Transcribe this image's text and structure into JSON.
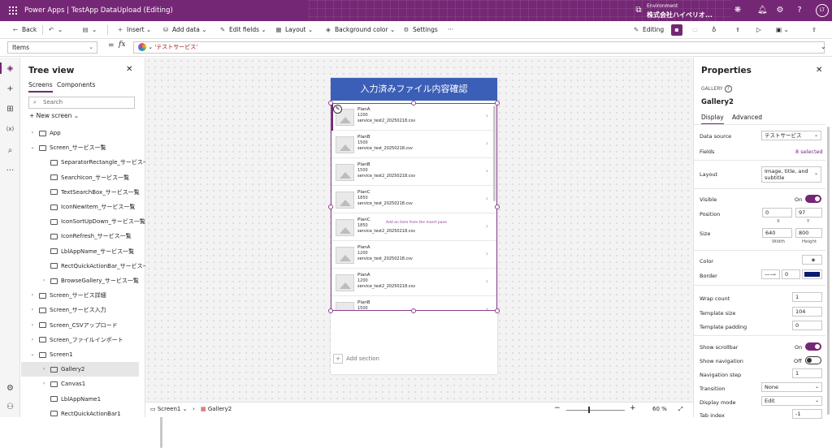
{
  "topbar": {
    "app_name": "Power Apps",
    "separator": "|",
    "doc_title": "TestApp DataUpload (Editing)",
    "env_label": "Environment",
    "env_name": "株式会社ハイペリオ...",
    "avatar": "LT"
  },
  "commandbar": {
    "back": "Back",
    "insert": "Insert",
    "add_data": "Add data",
    "edit_fields": "Edit fields",
    "layout": "Layout",
    "background_color": "Background color",
    "settings": "Settings",
    "more": "···",
    "editing": "Editing"
  },
  "formula": {
    "property": "Items",
    "equals": "=",
    "fx": "fx",
    "value": "'テストサービス'"
  },
  "tree": {
    "title": "Tree view",
    "tabs": [
      "Screens",
      "Components"
    ],
    "search_placeholder": "Search",
    "new_screen": "New screen",
    "nodes": [
      {
        "label": "App",
        "indent": 0,
        "icon": "app-icon",
        "chev": "›"
      },
      {
        "label": "Screen_サービス一覧",
        "indent": 0,
        "icon": "screen-icon",
        "chev": "⌄"
      },
      {
        "label": "SeparatorRectangle_サービス一覧",
        "indent": 1,
        "icon": "rectangle-icon",
        "chev": ""
      },
      {
        "label": "SearchIcon_サービス一覧",
        "indent": 1,
        "icon": "icon-icon",
        "chev": ""
      },
      {
        "label": "TextSearchBox_サービス一覧",
        "indent": 1,
        "icon": "textinput-icon",
        "chev": ""
      },
      {
        "label": "IconNewItem_サービス一覧",
        "indent": 1,
        "icon": "icon-icon",
        "chev": ""
      },
      {
        "label": "IconSortUpDown_サービス一覧",
        "indent": 1,
        "icon": "icon-icon",
        "chev": ""
      },
      {
        "label": "IconRefresh_サービス一覧",
        "indent": 1,
        "icon": "icon-icon",
        "chev": ""
      },
      {
        "label": "LblAppName_サービス一覧",
        "indent": 1,
        "icon": "label-icon",
        "chev": ""
      },
      {
        "label": "RectQuickActionBar_サービス一覧",
        "indent": 1,
        "icon": "rectangle-icon",
        "chev": ""
      },
      {
        "label": "BrowseGallery_サービス一覧",
        "indent": 1,
        "icon": "gallery-icon",
        "chev": "›"
      },
      {
        "label": "Screen_サービス詳細",
        "indent": 0,
        "icon": "screen-icon",
        "chev": "›"
      },
      {
        "label": "Screen_サービス入力",
        "indent": 0,
        "icon": "screen-icon",
        "chev": "›"
      },
      {
        "label": "Screen_CSVアップロード",
        "indent": 0,
        "icon": "screen-icon",
        "chev": "›"
      },
      {
        "label": "Screen_ファイルインポート",
        "indent": 0,
        "icon": "screen-icon",
        "chev": "›"
      },
      {
        "label": "Screen1",
        "indent": 0,
        "icon": "screen-icon",
        "chev": "⌄"
      },
      {
        "label": "Gallery2",
        "indent": 1,
        "icon": "gallery-icon",
        "chev": "›",
        "selected": true
      },
      {
        "label": "Canvas1",
        "indent": 1,
        "icon": "canvas-icon",
        "chev": "›"
      },
      {
        "label": "LblAppName1",
        "indent": 1,
        "icon": "label-icon",
        "chev": ""
      },
      {
        "label": "RectQuickActionBar1",
        "indent": 1,
        "icon": "rectangle-icon",
        "chev": ""
      }
    ]
  },
  "canvas": {
    "header": "入力済みファイル内容確認",
    "hint": "Add an item from the Insert pane",
    "add_section": "Add section",
    "items": [
      {
        "title": "PlanA",
        "value": "1200",
        "file": "service_test2_20250218.csv"
      },
      {
        "title": "PlanB",
        "value": "1500",
        "file": "service_test_20250218.csv"
      },
      {
        "title": "PlanB",
        "value": "1500",
        "file": "service_test2_20250218.csv"
      },
      {
        "title": "PlanC",
        "value": "1850",
        "file": "service_test_20250218.csv"
      },
      {
        "title": "PlanC",
        "value": "1850",
        "file": "service_test2_20250218.csv"
      },
      {
        "title": "PlanA",
        "value": "1200",
        "file": "service_test_20250218.csv"
      },
      {
        "title": "PlanA",
        "value": "1200",
        "file": "service_test2_20250218.csv"
      },
      {
        "title": "PlanB",
        "value": "1500",
        "file": ""
      }
    ]
  },
  "bottombar": {
    "screen": "Screen1",
    "control": "Gallery2",
    "minus": "−",
    "plus": "+",
    "zoom": "60 %"
  },
  "props": {
    "title": "Properties",
    "type": "GALLERY",
    "name": "Gallery2",
    "tabs": [
      "Display",
      "Advanced"
    ],
    "data_source_label": "Data source",
    "data_source": "テストサービス",
    "fields_label": "Fields",
    "fields_value": "8 selected",
    "layout_label": "Layout",
    "layout_value": "Image, title, and subtitle",
    "visible_label": "Visible",
    "visible_value": "On",
    "position_label": "Position",
    "pos_x": "0",
    "pos_y": "97",
    "x_lbl": "X",
    "y_lbl": "Y",
    "size_label": "Size",
    "width": "640",
    "height": "800",
    "w_lbl": "Width",
    "h_lbl": "Height",
    "color_label": "Color",
    "border_label": "Border",
    "border_style": "——",
    "border_width": "0",
    "border_color": "#0b1c6e",
    "wrap_label": "Wrap count",
    "wrap_value": "1",
    "template_size_label": "Template size",
    "template_size": "104",
    "template_padding_label": "Template padding",
    "template_padding": "0",
    "scrollbar_label": "Show scrollbar",
    "scrollbar_value": "On",
    "navigation_label": "Show navigation",
    "navigation_value": "Off",
    "nav_step_label": "Navigation step",
    "nav_step": "1",
    "transition_label": "Transition",
    "transition_value": "None",
    "display_mode_label": "Display mode",
    "display_mode_value": "Edit",
    "tab_index_label": "Tab index",
    "tab_index": "-1"
  },
  "colors": {
    "brand": "#742774",
    "header_blue": "#3b5fb6",
    "selection": "#8d3f8d"
  }
}
